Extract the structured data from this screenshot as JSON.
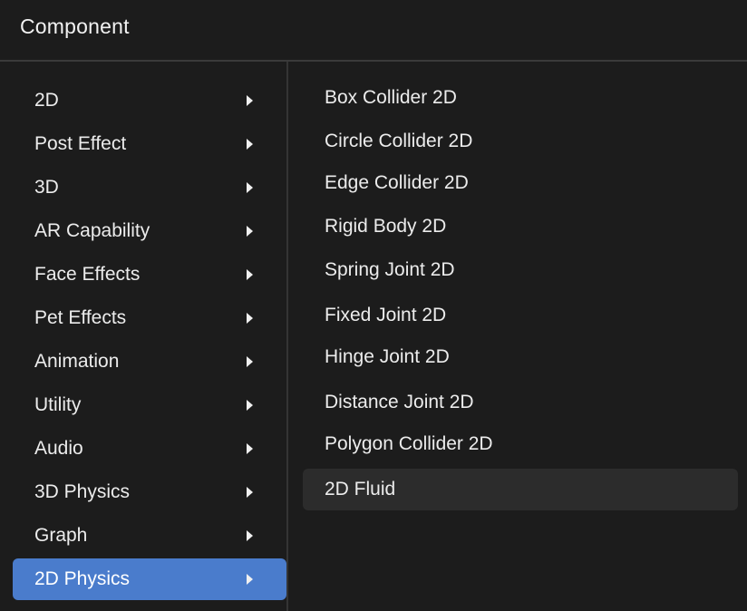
{
  "header": {
    "title": "Component"
  },
  "categories": [
    {
      "label": "2D"
    },
    {
      "label": "Post Effect"
    },
    {
      "label": "3D"
    },
    {
      "label": "AR Capability"
    },
    {
      "label": "Face Effects"
    },
    {
      "label": "Pet Effects"
    },
    {
      "label": "Animation"
    },
    {
      "label": "Utility"
    },
    {
      "label": "Audio"
    },
    {
      "label": "3D Physics"
    },
    {
      "label": "Graph"
    },
    {
      "label": "2D Physics"
    }
  ],
  "selected_category": "2D Physics",
  "submenu": [
    {
      "label": "Box Collider 2D"
    },
    {
      "label": "Circle Collider 2D"
    },
    {
      "label": "Edge Collider 2D"
    },
    {
      "label": "Rigid Body 2D"
    },
    {
      "label": "Spring Joint 2D"
    },
    {
      "label": "Fixed Joint 2D"
    },
    {
      "label": "Hinge Joint 2D"
    },
    {
      "label": "Distance Joint 2D"
    },
    {
      "label": "Polygon Collider 2D"
    },
    {
      "label": "2D Fluid"
    }
  ],
  "hovered_submenu_item": "2D Fluid",
  "colors": {
    "background": "#1c1c1c",
    "selected": "#4a7ccc",
    "hover": "#2c2c2c",
    "divider": "#343434"
  }
}
